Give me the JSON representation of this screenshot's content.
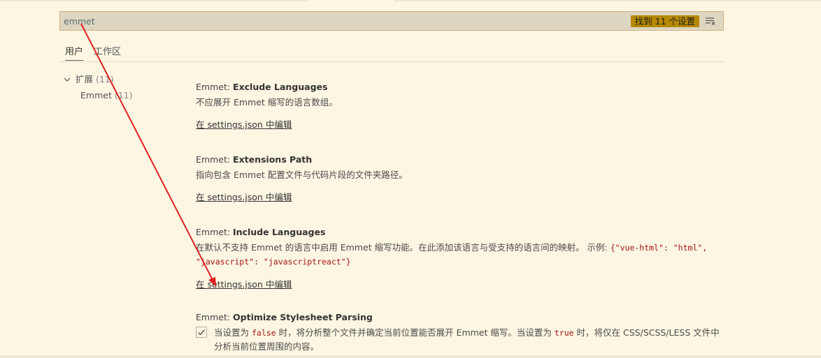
{
  "search": {
    "value": "emmet",
    "count_label": "找到 11 个设置",
    "clear_icon": "clear-filter-icon"
  },
  "tabs": [
    {
      "label": "用户",
      "active": true
    },
    {
      "label": "工作区",
      "active": false
    }
  ],
  "toc": {
    "group_label": "扩展",
    "group_count": "(11)",
    "item_label": "Emmet",
    "item_count": "(11)"
  },
  "settings": [
    {
      "category": "Emmet: ",
      "label": "Exclude Languages",
      "description": "不应展开 Emmet 缩写的语言数组。",
      "edit_link": "在 settings.json 中编辑"
    },
    {
      "category": "Emmet: ",
      "label": "Extensions Path",
      "description": "指向包含 Emmet 配置文件与代码片段的文件夹路径。",
      "edit_link": "在 settings.json 中编辑"
    },
    {
      "category": "Emmet: ",
      "label": "Include Languages",
      "description_pre": "在默认不支持 Emmet 的语言中启用 Emmet 缩写功能。在此添加该语言与受支持的语言间的映射。 示例: ",
      "description_code": "{\"vue-html\": \"html\", \"javascript\": \"javascriptreact\"}",
      "edit_link": "在 settings.json 中编辑"
    },
    {
      "category": "Emmet: ",
      "label": "Optimize Stylesheet Parsing",
      "checked": true,
      "desc_part1": "当设置为 ",
      "desc_code1": "false",
      "desc_part2": " 时，将分析整个文件并确定当前位置能否展开 Emmet 缩写。当设置为 ",
      "desc_code2": "true",
      "desc_part3": " 时，将仅在 CSS/SCSS/LESS 文件中分析当前位置周围的内容。"
    }
  ],
  "colors": {
    "background": "#fdf6e3",
    "search_background": "#ddd6c1",
    "badge": "#b58900",
    "annotation_arrow": "#e02020"
  }
}
